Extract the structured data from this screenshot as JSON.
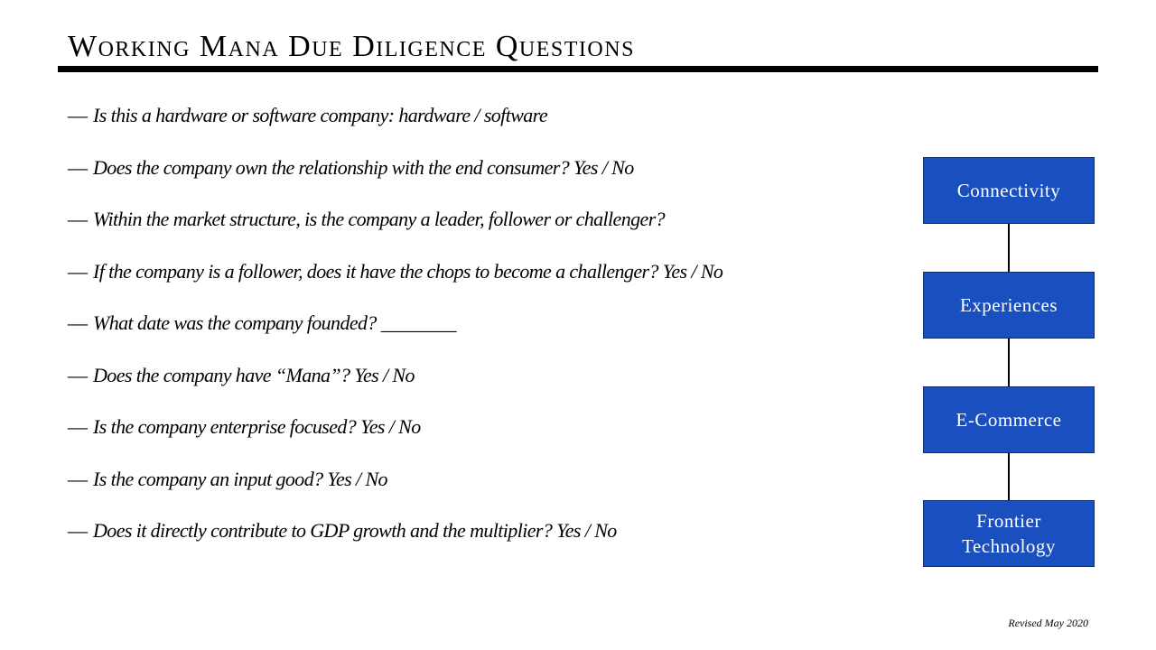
{
  "title": "Working Mana Due Diligence Questions",
  "questions": [
    "Is this a hardware or software company: hardware / software",
    "Does the company own the relationship with the end consumer?  Yes / No",
    "Within the market structure, is the company a leader, follower or challenger?",
    "If the company is a follower, does it have the chops to become a challenger? Yes / No",
    "What date was the company founded? ________",
    "Does the company have “Mana”? Yes / No",
    "Is the company enterprise focused? Yes / No",
    "Is the company an input good? Yes / No",
    "Does it directly contribute to GDP growth and the multiplier? Yes / No"
  ],
  "bullet": "—",
  "diagram": {
    "boxes": [
      "Connectivity",
      "Experiences",
      "E-Commerce",
      "Frontier\nTechnology"
    ],
    "box_color": "#1a4fc0"
  },
  "footer": "Revised May 2020"
}
